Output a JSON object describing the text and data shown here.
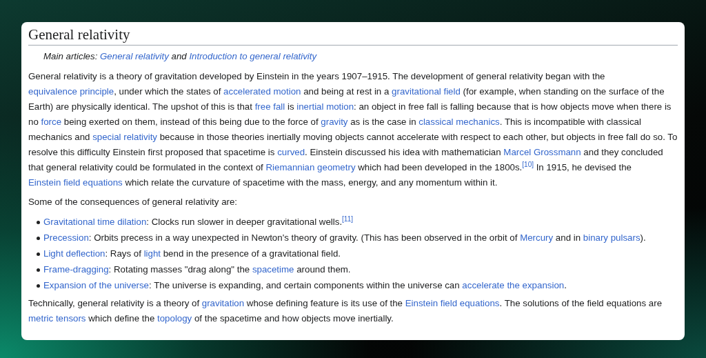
{
  "section": {
    "title": "General relativity",
    "main_articles": [
      {
        "text": "Main articles: ",
        "kind": "text"
      },
      {
        "text": "General relativity",
        "kind": "link"
      },
      {
        "text": " and ",
        "kind": "text"
      },
      {
        "text": "Introduction to general relativity",
        "kind": "link"
      }
    ],
    "paragraphs_before": [
      [
        {
          "text": "General relativity is a theory of gravitation developed by Einstein in the years 1907–1915. The development of general relativity began with the ",
          "kind": "text"
        },
        {
          "text": "equivalence principle",
          "kind": "link"
        },
        {
          "text": ", under which the states of ",
          "kind": "text"
        },
        {
          "text": "accelerated motion",
          "kind": "link"
        },
        {
          "text": " and being at rest in a ",
          "kind": "text"
        },
        {
          "text": "gravitational field",
          "kind": "link"
        },
        {
          "text": " (for example, when standing on the surface of the Earth) are physically identical. The upshot of this is that ",
          "kind": "text"
        },
        {
          "text": "free fall",
          "kind": "link"
        },
        {
          "text": " is ",
          "kind": "text"
        },
        {
          "text": "inertial motion",
          "kind": "link"
        },
        {
          "text": ": an object in free fall is falling because that is how objects move when there is no ",
          "kind": "text"
        },
        {
          "text": "force",
          "kind": "link"
        },
        {
          "text": " being exerted on them, instead of this being due to the force of ",
          "kind": "text"
        },
        {
          "text": "gravity",
          "kind": "link"
        },
        {
          "text": " as is the case in ",
          "kind": "text"
        },
        {
          "text": "classical mechanics",
          "kind": "link"
        },
        {
          "text": ". This is incompatible with classical mechanics and ",
          "kind": "text"
        },
        {
          "text": "special relativity",
          "kind": "link"
        },
        {
          "text": " because in those theories inertially moving objects cannot accelerate with respect to each other, but objects in free fall do so. To resolve this difficulty Einstein first proposed that spacetime is ",
          "kind": "text"
        },
        {
          "text": "curved",
          "kind": "link"
        },
        {
          "text": ". Einstein discussed his idea with mathematician ",
          "kind": "text"
        },
        {
          "text": "Marcel Grossmann",
          "kind": "link"
        },
        {
          "text": " and they concluded that general relativity could be formulated in the context of ",
          "kind": "text"
        },
        {
          "text": "Riemannian geometry",
          "kind": "link"
        },
        {
          "text": " which had been developed in the 1800s.",
          "kind": "text"
        },
        {
          "text": "[10]",
          "kind": "ref"
        },
        {
          "text": " In 1915, he devised the ",
          "kind": "text"
        },
        {
          "text": "Einstein field equations",
          "kind": "link"
        },
        {
          "text": " which relate the curvature of spacetime with the mass, energy, and any momentum within it.",
          "kind": "text"
        }
      ],
      [
        {
          "text": "Some of the consequences of general relativity are:",
          "kind": "text"
        }
      ]
    ],
    "consequences": [
      [
        {
          "text": "Gravitational time dilation",
          "kind": "link"
        },
        {
          "text": ": Clocks run slower in deeper gravitational wells.",
          "kind": "text"
        },
        {
          "text": "[11]",
          "kind": "ref"
        }
      ],
      [
        {
          "text": "Precession",
          "kind": "link"
        },
        {
          "text": ": Orbits precess in a way unexpected in Newton's theory of gravity. (This has been observed in the orbit of ",
          "kind": "text"
        },
        {
          "text": "Mercury",
          "kind": "link"
        },
        {
          "text": " and in ",
          "kind": "text"
        },
        {
          "text": "binary pulsars",
          "kind": "link"
        },
        {
          "text": ").",
          "kind": "text"
        }
      ],
      [
        {
          "text": "Light deflection",
          "kind": "link"
        },
        {
          "text": ": Rays of ",
          "kind": "text"
        },
        {
          "text": "light",
          "kind": "link"
        },
        {
          "text": " bend in the presence of a gravitational field.",
          "kind": "text"
        }
      ],
      [
        {
          "text": "Frame-dragging",
          "kind": "link"
        },
        {
          "text": ": Rotating masses \"drag along\" the ",
          "kind": "text"
        },
        {
          "text": "spacetime",
          "kind": "link"
        },
        {
          "text": " around them.",
          "kind": "text"
        }
      ],
      [
        {
          "text": "Expansion of the universe",
          "kind": "link"
        },
        {
          "text": ": The universe is expanding, and certain components within the universe can ",
          "kind": "text"
        },
        {
          "text": "accelerate the expansion",
          "kind": "link"
        },
        {
          "text": ".",
          "kind": "text"
        }
      ]
    ],
    "paragraphs_after": [
      [
        {
          "text": "Technically, general relativity is a theory of ",
          "kind": "text"
        },
        {
          "text": "gravitation",
          "kind": "link"
        },
        {
          "text": " whose defining feature is its use of the ",
          "kind": "text"
        },
        {
          "text": "Einstein field equations",
          "kind": "link"
        },
        {
          "text": ". The solutions of the field equations are ",
          "kind": "text"
        },
        {
          "text": "metric tensors",
          "kind": "link"
        },
        {
          "text": " which define the ",
          "kind": "text"
        },
        {
          "text": "topology",
          "kind": "link"
        },
        {
          "text": " of the spacetime and how objects move inertially.",
          "kind": "text"
        }
      ]
    ]
  }
}
